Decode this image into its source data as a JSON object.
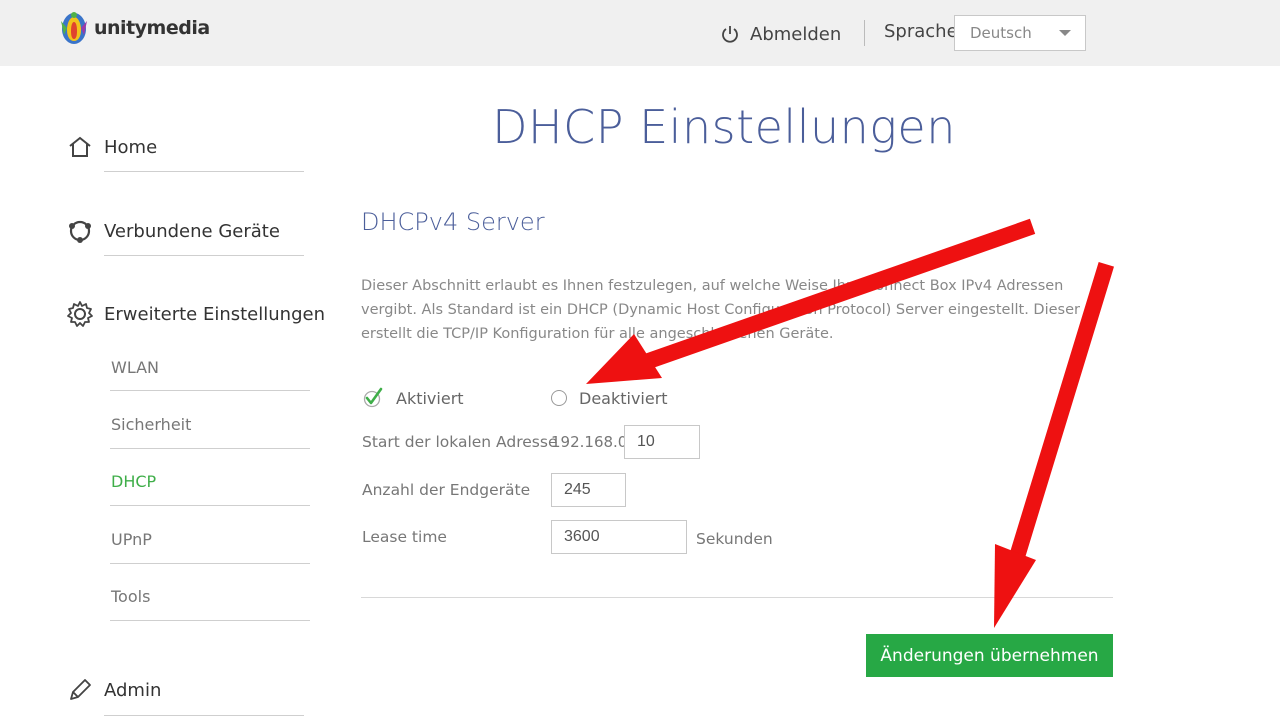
{
  "header": {
    "logo_text": "unitymedia",
    "logout_label": "Abmelden",
    "language_label": "Sprache",
    "language_selected": "Deutsch"
  },
  "sidebar": {
    "items": [
      {
        "label": "Home",
        "icon": "home-icon"
      },
      {
        "label": "Verbundene Geräte",
        "icon": "devices-icon"
      },
      {
        "label": "Erweiterte Einstellungen",
        "icon": "gear-icon"
      },
      {
        "label": "Admin",
        "icon": "pencil-icon"
      }
    ],
    "sub_items": [
      {
        "label": "WLAN",
        "active": false
      },
      {
        "label": "Sicherheit",
        "active": false
      },
      {
        "label": "DHCP",
        "active": true
      },
      {
        "label": "UPnP",
        "active": false
      },
      {
        "label": "Tools",
        "active": false
      }
    ],
    "active_color": "#3fae49"
  },
  "main": {
    "title": "DHCP Einstellungen",
    "section_title": "DHCPv4 Server",
    "description": "Dieser Abschnitt erlaubt es Ihnen festzulegen, auf welche Weise Ihre Connect Box IPv4 Adressen vergibt. Als Standard ist ein DHCP (Dynamic Host Configuration Protocol) Server eingestellt. Dieser erstellt die TCP/IP Konfiguration für alle angeschlossenen Geräte.",
    "radio_activated": "Aktiviert",
    "radio_deactivated": "Deaktiviert",
    "selected_option": "Aktiviert",
    "start_address_label": "Start der lokalen Adresse",
    "ip_prefix": "192.168.0.",
    "start_address_value": "10",
    "device_count_label": "Anzahl der Endgeräte",
    "device_count_value": "245",
    "lease_time_label": "Lease time",
    "lease_time_value": "3600",
    "lease_time_unit": "Sekunden",
    "apply_button": "Änderungen übernehmen"
  },
  "colors": {
    "title_blue": "#4b5e9a",
    "button_green": "#27a845",
    "annotation_red": "#ee1111"
  }
}
